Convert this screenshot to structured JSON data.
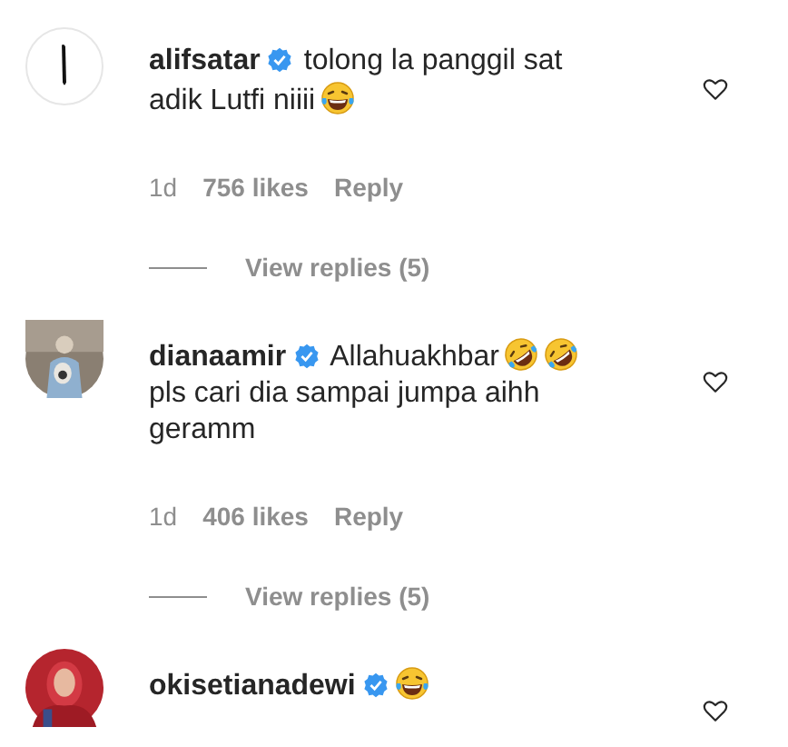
{
  "comments": [
    {
      "username": "alifsatar",
      "verified": true,
      "body": [
        {
          "kind": "text",
          "text": "tolong la panggil sat"
        },
        {
          "kind": "text",
          "text": "adik Lutfi niiii"
        },
        {
          "kind": "joy"
        }
      ],
      "age": "1d",
      "likes": "756 likes",
      "reply": "Reply",
      "view_replies": "View replies (5)",
      "liked": false
    },
    {
      "username": "dianaamir",
      "verified": true,
      "body": [
        {
          "kind": "text",
          "text": "Allahuakhbar"
        },
        {
          "kind": "rofl"
        },
        {
          "kind": "rofl"
        },
        {
          "kind": "text",
          "text": "pls cari dia sampai jumpa aihh"
        },
        {
          "kind": "text",
          "text": "geramm"
        }
      ],
      "age": "1d",
      "likes": "406 likes",
      "reply": "Reply",
      "view_replies": "View replies (5)",
      "liked": false
    },
    {
      "username": "okisetianadewi",
      "verified": true,
      "body": [
        {
          "kind": "joy"
        }
      ],
      "liked": false
    }
  ]
}
